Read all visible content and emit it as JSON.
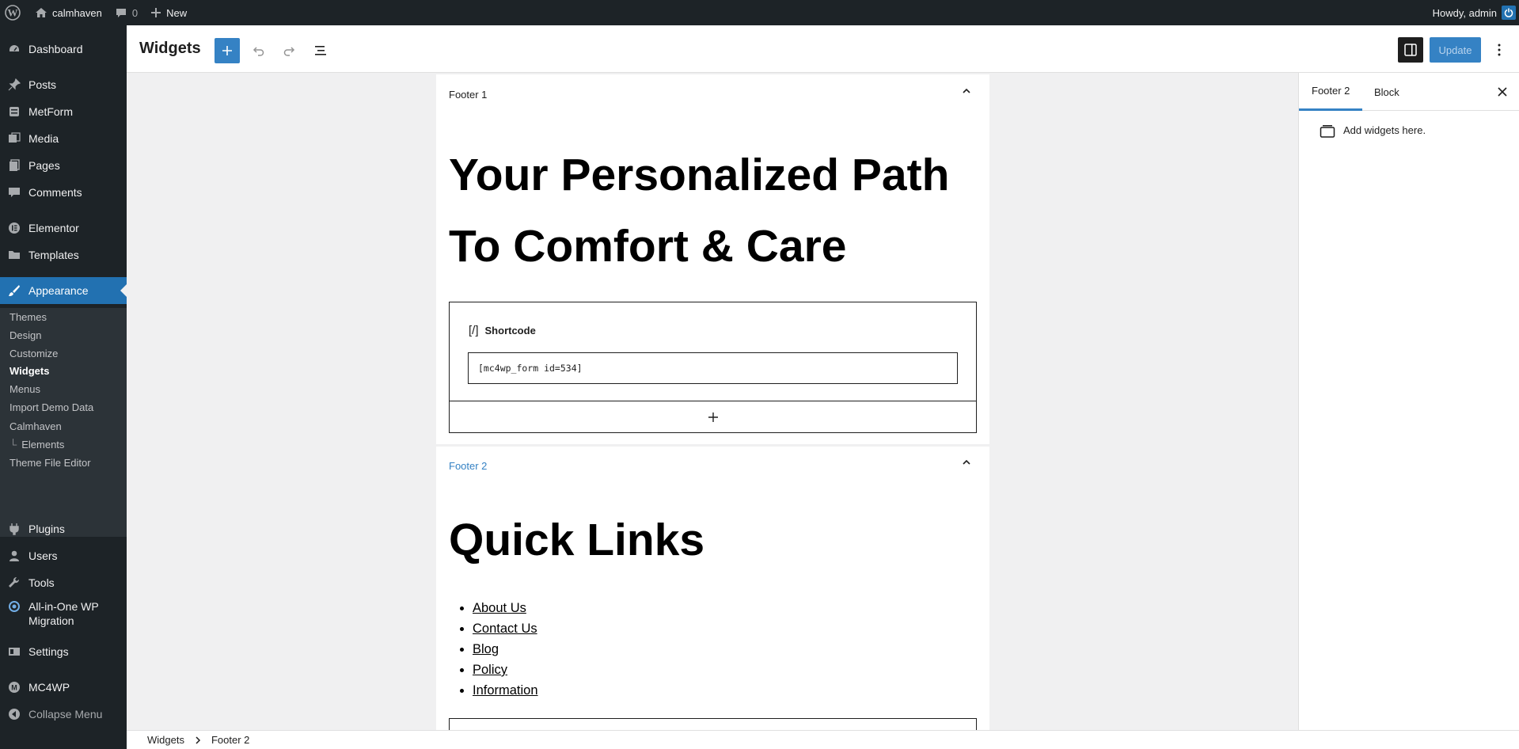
{
  "admin_bar": {
    "site_name": "calmhaven",
    "comments_count": "0",
    "new_label": "New",
    "greeting": "Howdy, admin"
  },
  "sidebar": {
    "items": [
      {
        "label": "Dashboard",
        "icon": "dashboard-icon"
      },
      {
        "label": "Posts",
        "icon": "pin-icon"
      },
      {
        "label": "MetForm",
        "icon": "form-icon"
      },
      {
        "label": "Media",
        "icon": "media-icon"
      },
      {
        "label": "Pages",
        "icon": "page-icon"
      },
      {
        "label": "Comments",
        "icon": "comment-icon"
      },
      {
        "label": "Elementor",
        "icon": "elementor-icon"
      },
      {
        "label": "Templates",
        "icon": "folder-icon"
      },
      {
        "label": "Appearance",
        "icon": "brush-icon"
      },
      {
        "label": "Plugins",
        "icon": "plugin-icon"
      },
      {
        "label": "Users",
        "icon": "user-icon"
      },
      {
        "label": "Tools",
        "icon": "wrench-icon"
      },
      {
        "label": "All-in-One WP Migration",
        "icon": "migration-icon"
      },
      {
        "label": "Settings",
        "icon": "settings-icon"
      },
      {
        "label": "MC4WP",
        "icon": "mc4wp-icon"
      },
      {
        "label": "Collapse Menu",
        "icon": "collapse-icon"
      }
    ],
    "appearance_submenu": [
      "Themes",
      "Design",
      "Customize",
      "Widgets",
      "Menus",
      "Import Demo Data",
      "Calmhaven",
      "Elements",
      "Theme File Editor"
    ],
    "elements_prefix": "└"
  },
  "header": {
    "title": "Widgets",
    "update_label": "Update"
  },
  "canvas": {
    "footer1": {
      "title": "Footer 1",
      "heading_line1": "Your Personalized Path",
      "heading_line2": "To Comfort & Care",
      "shortcode_label": "Shortcode",
      "shortcode_icon": "[/]",
      "shortcode_value": "[mc4wp_form id=534]"
    },
    "footer2": {
      "title": "Footer 2",
      "heading": "Quick Links",
      "links": [
        "About Us",
        "Contact Us",
        "Blog",
        "Policy",
        "Information"
      ]
    }
  },
  "panel": {
    "tabs": [
      "Footer 2",
      "Block"
    ],
    "message": "Add widgets here."
  },
  "breadcrumb": {
    "items": [
      "Widgets",
      "Footer 2"
    ]
  },
  "colors": {
    "admin_dark": "#1d2327",
    "accent": "#2271b1",
    "wp_blue": "#3582c4"
  }
}
